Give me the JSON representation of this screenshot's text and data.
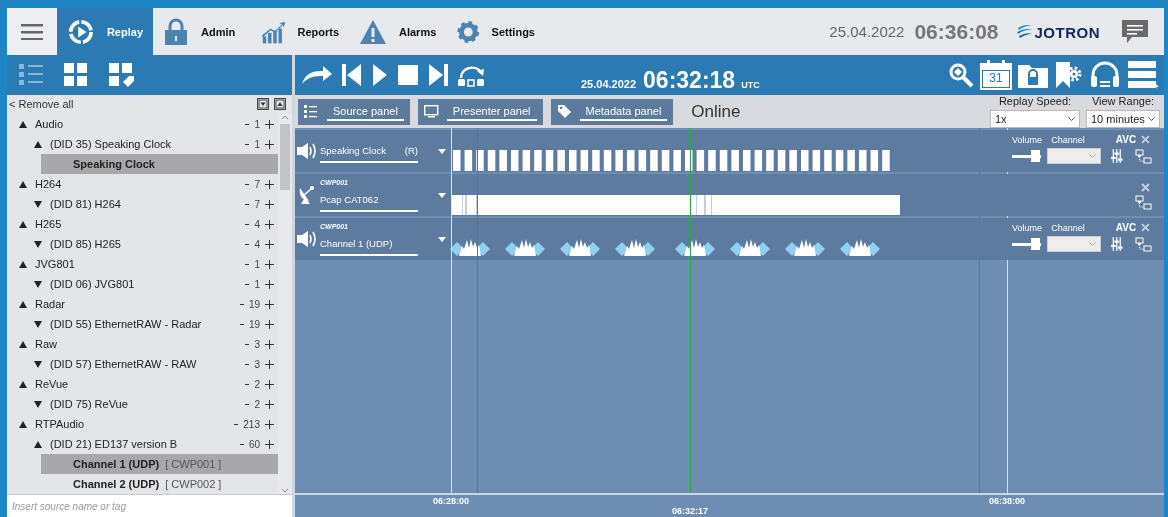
{
  "top_bar": {
    "tabs": [
      {
        "label": "Replay",
        "selected": true
      },
      {
        "label": "Admin",
        "selected": false
      },
      {
        "label": "Reports",
        "selected": false
      },
      {
        "label": "Alarms",
        "selected": false
      },
      {
        "label": "Settings",
        "selected": false
      }
    ],
    "date": "25.04.2022",
    "time": "06:36:08",
    "logo": "JOTRON"
  },
  "toolbar": {
    "view_modes": [
      {
        "kind": "list",
        "selected": true
      },
      {
        "kind": "grid",
        "selected": false
      },
      {
        "kind": "grid-tag",
        "selected": false
      }
    ],
    "date": "25.04.2022",
    "time": "06:32:18",
    "timezone": "UTC",
    "calendar_day": "31"
  },
  "source_tree": {
    "remove_all": "< Remove all",
    "items": [
      {
        "label": "Audio",
        "expanded": true,
        "count": "1",
        "children": [
          {
            "label": "(DID 35) Speaking Clock",
            "expanded": true,
            "count": "1",
            "children": [
              {
                "label": "Speaking Clock",
                "selected": true
              }
            ]
          }
        ]
      },
      {
        "label": "H264",
        "expanded": true,
        "count": "7",
        "children": [
          {
            "label": "(DID 81) H264",
            "expanded": false,
            "count": "7"
          }
        ]
      },
      {
        "label": "H265",
        "expanded": true,
        "count": "4",
        "children": [
          {
            "label": "(DID 85) H265",
            "expanded": false,
            "count": "4"
          }
        ]
      },
      {
        "label": "JVG801",
        "expanded": true,
        "count": "1",
        "children": [
          {
            "label": "(DID 06) JVG801",
            "expanded": false,
            "count": "1"
          }
        ]
      },
      {
        "label": "Radar",
        "expanded": true,
        "count": "19",
        "children": [
          {
            "label": "(DID 55) EthernetRAW - Radar",
            "expanded": false,
            "count": "19"
          }
        ]
      },
      {
        "label": "Raw",
        "expanded": true,
        "count": "3",
        "children": [
          {
            "label": "(DID 57) EthernetRAW - RAW",
            "expanded": false,
            "count": "3"
          }
        ]
      },
      {
        "label": "ReVue",
        "expanded": true,
        "count": "2",
        "children": [
          {
            "label": "(DID 75) ReVue",
            "expanded": false,
            "count": "2"
          }
        ]
      },
      {
        "label": "RTPAudio",
        "expanded": true,
        "count": "213",
        "children": [
          {
            "label": "(DID 21) ED137 version B",
            "expanded": true,
            "count": "60",
            "children": [
              {
                "label": "Channel 1 (UDP)",
                "tag": "[ CWP001 ]",
                "selected": true
              },
              {
                "label": "Channel 2 (UDP)",
                "tag": "[ CWP002 ]",
                "selected": false
              }
            ]
          }
        ]
      }
    ],
    "search": {
      "placeholder": "Insert source name or tag"
    }
  },
  "panel_bar": {
    "tabs": [
      {
        "label": "Source panel"
      },
      {
        "label": "Presenter panel"
      },
      {
        "label": "Metadata panel"
      }
    ],
    "status": "Online",
    "replay_speed": {
      "label": "Replay Speed:",
      "value": "1x"
    },
    "view_range": {
      "label": "View Range:",
      "value": "10 minutes"
    }
  },
  "tracks": [
    {
      "kind": "audio",
      "name": "Speaking Clock",
      "badge": "(R)",
      "volume_label": "Volume",
      "channel_label": "Channel",
      "avc_label": "AVC",
      "volume": {
        "level": 0.82
      }
    },
    {
      "kind": "radar",
      "tag": "CWP001",
      "name": "Pcap CAT062"
    },
    {
      "kind": "audio",
      "tag": "CWP001",
      "name": "Channel 1 (UDP)",
      "volume_label": "Volume",
      "channel_label": "Channel",
      "avc_label": "AVC",
      "volume": {
        "level": 0.82
      }
    }
  ],
  "timeline": {
    "ticks": [
      "06:28:00",
      "06:38:00"
    ],
    "cursor": "06:32:17"
  }
}
